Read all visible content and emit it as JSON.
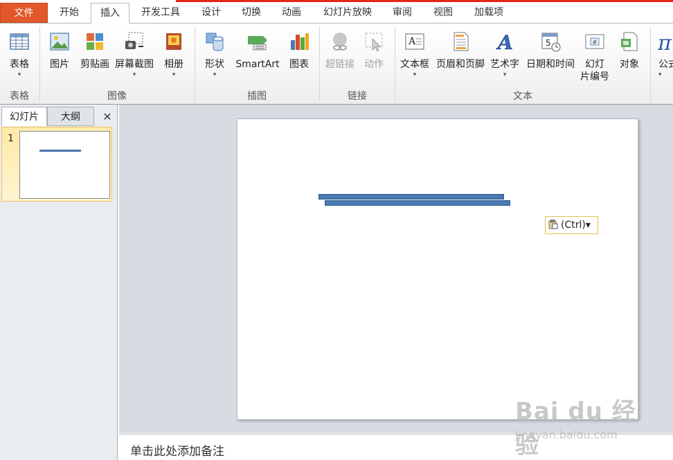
{
  "tabs": {
    "file": "文件",
    "home": "开始",
    "insert": "插入",
    "developer": "开发工具",
    "design": "设计",
    "transitions": "切换",
    "animations": "动画",
    "slideshow": "幻灯片放映",
    "review": "审阅",
    "view": "视图",
    "addins": "加载项"
  },
  "ribbon": {
    "table": "表格",
    "picture": "图片",
    "clipart": "剪贴画",
    "screenshot": "屏幕截图",
    "album": "相册",
    "shapes": "形状",
    "smartart": "SmartArt",
    "chart": "图表",
    "hyperlink": "超链接",
    "action": "动作",
    "textbox": "文本框",
    "header_footer": "页眉和页脚",
    "wordart": "艺术字",
    "datetime": "日期和时间",
    "slide_number_1": "幻灯",
    "slide_number_2": "片编号",
    "object": "对象",
    "equation": "公式",
    "arrow": "▾",
    "groups": {
      "tables": "表格",
      "images": "图像",
      "illustrations": "插图",
      "links": "链接",
      "text": "文本"
    }
  },
  "left_pane": {
    "tab_slides": "幻灯片",
    "tab_outline": "大纲",
    "close": "✕",
    "slide_number": "1"
  },
  "slide": {
    "paste_options": "(Ctrl)▾"
  },
  "notes": {
    "placeholder": "单击此处添加备注"
  },
  "watermark": {
    "line1": "Bai du 经验",
    "line2": "jingyan.baidu.com"
  },
  "colors": {
    "file_tab": "#e2582a",
    "accent_line": "#e8231a",
    "shape_fill": "#4a7ab5",
    "selected_thumb": "#ffe9a8"
  }
}
